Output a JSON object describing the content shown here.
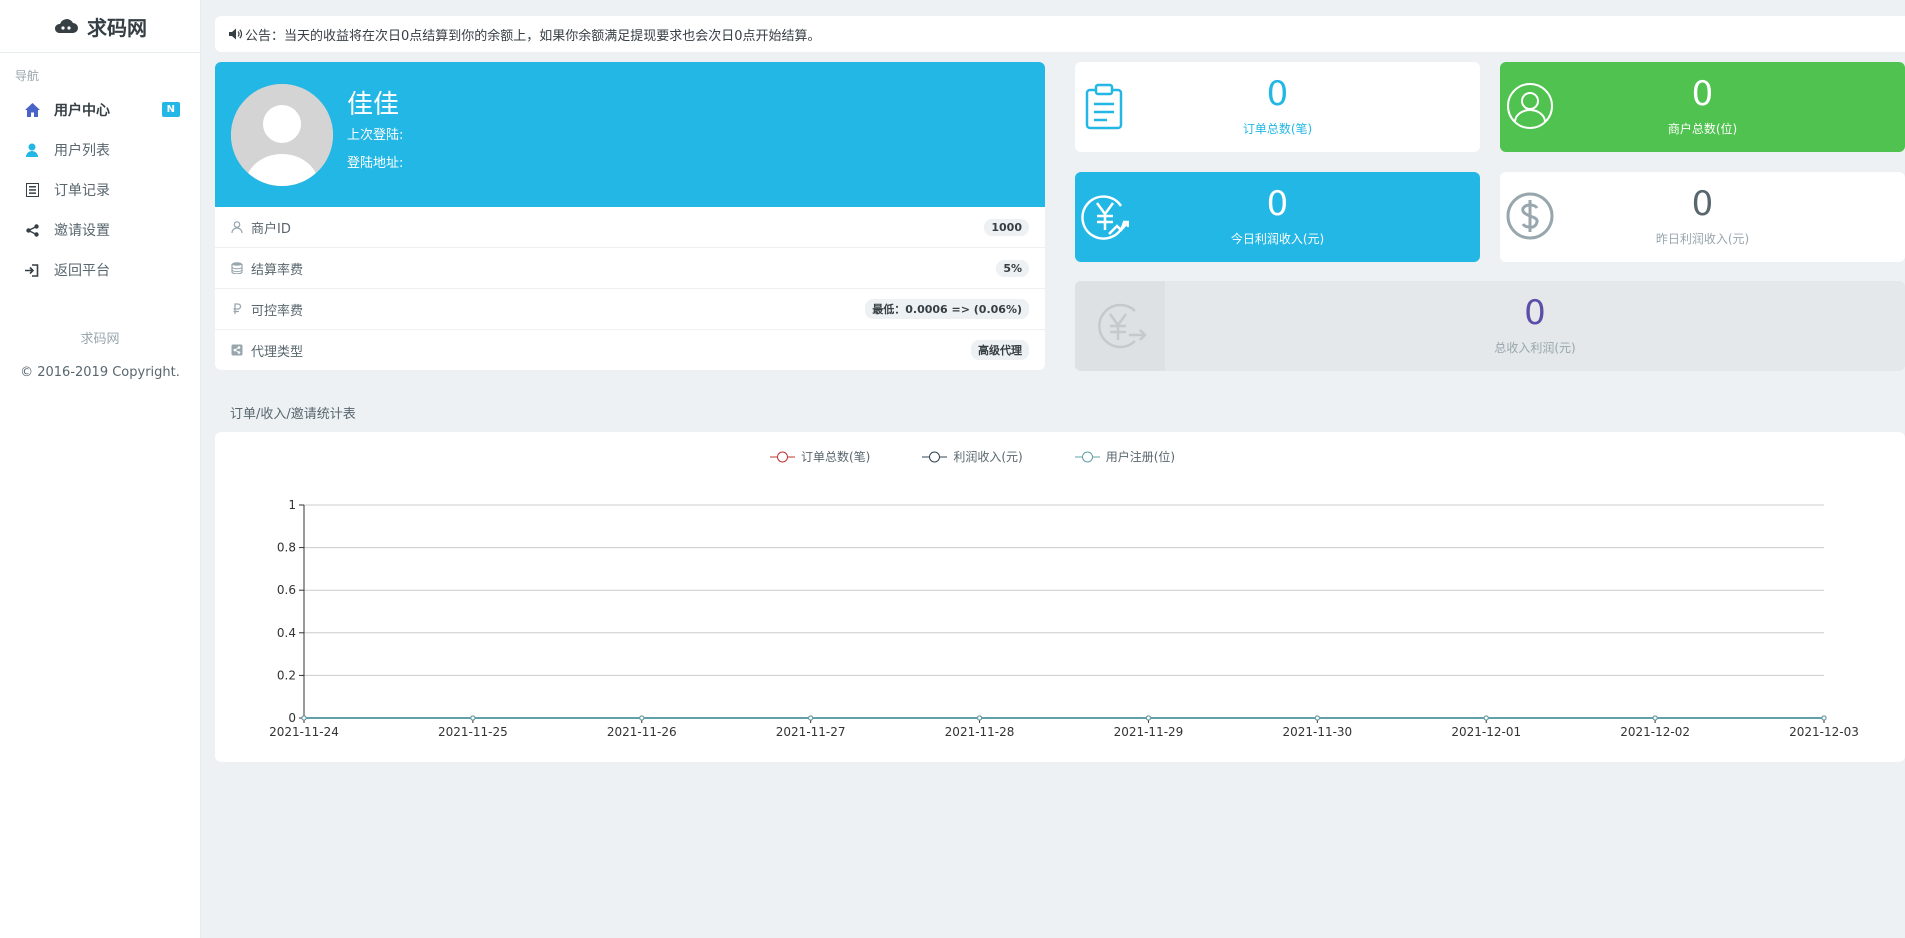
{
  "brand": {
    "name": "求码网"
  },
  "sidebar": {
    "heading": "导航",
    "items": [
      {
        "label": "用户中心",
        "icon": "home-icon",
        "active": true,
        "badge": "N"
      },
      {
        "label": "用户列表",
        "icon": "user-icon"
      },
      {
        "label": "订单记录",
        "icon": "list-icon"
      },
      {
        "label": "邀请设置",
        "icon": "share-icon"
      },
      {
        "label": "返回平台",
        "icon": "sign-in-icon"
      }
    ],
    "footer_name": "求码网",
    "copyright": "© 2016-2019 Copyright."
  },
  "notice": {
    "text": "公告：当天的收益将在次日0点结算到你的余额上，如果你余额满足提现要求也会次日0点开始结算。"
  },
  "profile": {
    "name": "佳佳",
    "last_login_label": "上次登陆:",
    "login_addr_label": "登陆地址:",
    "rows": [
      {
        "label": "商户ID",
        "value": "1000",
        "icon": "user-id-icon"
      },
      {
        "label": "结算率费",
        "value": "5%",
        "icon": "database-icon"
      },
      {
        "label": "可控率费",
        "value": "最低：0.0006 => (0.06%)",
        "icon": "ruble-icon"
      },
      {
        "label": "代理类型",
        "value": "高级代理",
        "icon": "share-square-icon"
      }
    ]
  },
  "stats": {
    "orders": {
      "value": "0",
      "label": "订单总数(笔)"
    },
    "merchants": {
      "value": "0",
      "label": "商户总数(位)"
    },
    "today_profit": {
      "value": "0",
      "label": "今日利润收入(元)"
    },
    "yesterday_profit": {
      "value": "0",
      "label": "昨日利润收入(元)"
    },
    "total_profit": {
      "value": "0",
      "label": "总收入利润(元)"
    }
  },
  "colors": {
    "accent": "#23b7e5",
    "success": "#4fc24f",
    "purple": "#5b4ea8"
  },
  "chart_title": "订单/收入/邀请统计表",
  "chart_data": {
    "type": "line",
    "x": [
      "2021-11-24",
      "2021-11-25",
      "2021-11-26",
      "2021-11-27",
      "2021-11-28",
      "2021-11-29",
      "2021-11-30",
      "2021-12-01",
      "2021-12-02",
      "2021-12-03"
    ],
    "series": [
      {
        "name": "订单总数(笔)",
        "color": "#c23531",
        "values": [
          0,
          0,
          0,
          0,
          0,
          0,
          0,
          0,
          0,
          0
        ]
      },
      {
        "name": "利润收入(元)",
        "color": "#2f4554",
        "values": [
          0,
          0,
          0,
          0,
          0,
          0,
          0,
          0,
          0,
          0
        ]
      },
      {
        "name": "用户注册(位)",
        "color": "#61a0a8",
        "values": [
          0,
          0,
          0,
          0,
          0,
          0,
          0,
          0,
          0,
          0
        ]
      }
    ],
    "y_ticks": [
      "0",
      "0.2",
      "0.4",
      "0.6",
      "0.8",
      "1"
    ],
    "ylim": [
      0,
      1
    ],
    "grid": true,
    "legend_position": "top-center"
  }
}
